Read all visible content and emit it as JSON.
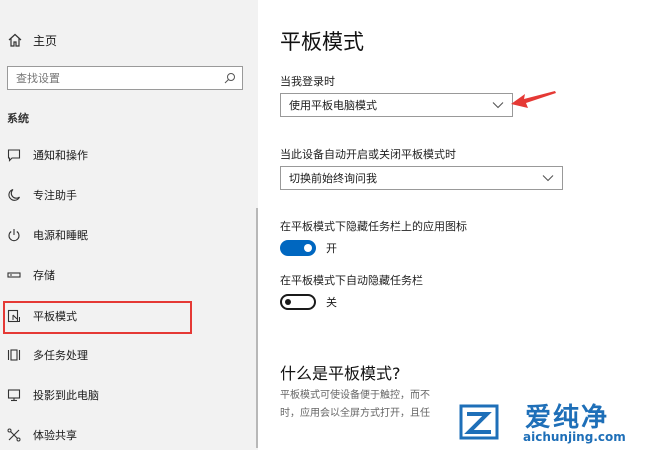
{
  "sidebar": {
    "home_label": "主页",
    "search_placeholder": "查找设置",
    "section_title": "系统",
    "items": [
      {
        "label": "通知和操作",
        "icon": "notification-icon"
      },
      {
        "label": "专注助手",
        "icon": "moon-icon"
      },
      {
        "label": "电源和睡眠",
        "icon": "power-icon"
      },
      {
        "label": "存储",
        "icon": "storage-icon"
      },
      {
        "label": "平板模式",
        "icon": "tablet-mode-icon",
        "selected": true
      },
      {
        "label": "多任务处理",
        "icon": "multitasking-icon"
      },
      {
        "label": "投影到此电脑",
        "icon": "project-icon"
      },
      {
        "label": "体验共享",
        "icon": "shared-experiences-icon"
      }
    ]
  },
  "main": {
    "title": "平板模式",
    "signin_label": "当我登录时",
    "signin_value": "使用平板电脑模式",
    "autoswitch_label": "当此设备自动开启或关闭平板模式时",
    "autoswitch_value": "切换前始终询问我",
    "hide_icons_label": "在平板模式下隐藏任务栏上的应用图标",
    "hide_icons_state": "开",
    "autohide_label": "在平板模式下自动隐藏任务栏",
    "autohide_state": "关",
    "what_is_title": "什么是平板模式?",
    "desc_line1": "平板模式可使设备便于触控，而不",
    "desc_line2": "时，应用会以全屏方式打开，且任"
  },
  "watermark": {
    "name": "爱纯净",
    "url": "aichunjing.com"
  },
  "colors": {
    "accent": "#0067c0",
    "highlight": "#e53935",
    "sidebar_bg": "#f2f2f2",
    "watermark": "#1e6fb8"
  }
}
